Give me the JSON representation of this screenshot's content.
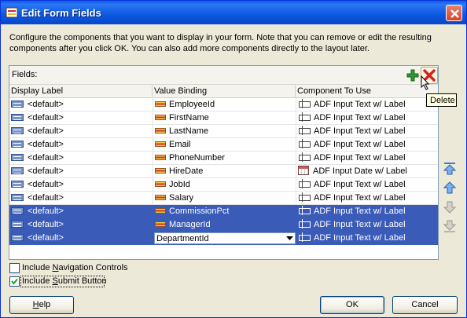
{
  "dialog": {
    "title": "Edit Form Fields",
    "description": "Configure the components that you want to display in your form.  Note that you can remove or edit the resulting components after you click OK.  You can also add more components directly to the layout later."
  },
  "fields": {
    "label": "Fields:",
    "add_icon": "add-icon",
    "delete_icon": "delete-icon",
    "tooltip": "Delete",
    "columns": [
      "Display Label",
      "Value Binding",
      "Component To Use"
    ],
    "rows": [
      {
        "label": "<default>",
        "binding": "EmployeeId",
        "component": "ADF Input Text w/ Label",
        "icon": "input-text-icon",
        "selected": false
      },
      {
        "label": "<default>",
        "binding": "FirstName",
        "component": "ADF Input Text w/ Label",
        "icon": "input-text-icon",
        "selected": false
      },
      {
        "label": "<default>",
        "binding": "LastName",
        "component": "ADF Input Text w/ Label",
        "icon": "input-text-icon",
        "selected": false
      },
      {
        "label": "<default>",
        "binding": "Email",
        "component": "ADF Input Text w/ Label",
        "icon": "input-text-icon",
        "selected": false
      },
      {
        "label": "<default>",
        "binding": "PhoneNumber",
        "component": "ADF Input Text w/ Label",
        "icon": "input-text-icon",
        "selected": false
      },
      {
        "label": "<default>",
        "binding": "HireDate",
        "component": "ADF Input Date w/ Label",
        "icon": "input-date-icon",
        "selected": false
      },
      {
        "label": "<default>",
        "binding": "JobId",
        "component": "ADF Input Text w/ Label",
        "icon": "input-text-icon",
        "selected": false
      },
      {
        "label": "<default>",
        "binding": "Salary",
        "component": "ADF Input Text w/ Label",
        "icon": "input-text-icon",
        "selected": false
      },
      {
        "label": "<default>",
        "binding": "CommissionPct",
        "component": "ADF Input Text w/ Label",
        "icon": "input-text-icon",
        "selected": true
      },
      {
        "label": "<default>",
        "binding": "ManagerId",
        "component": "ADF Input Text w/ Label",
        "icon": "input-text-icon",
        "selected": true
      },
      {
        "label": "<default>",
        "binding": "DepartmentId",
        "component": "ADF Input Text w/ Label",
        "icon": "input-text-icon",
        "selected": true,
        "editing": true
      }
    ]
  },
  "side_buttons": [
    "move-top-icon",
    "move-up-icon",
    "move-down-icon",
    "move-bottom-icon"
  ],
  "options": {
    "nav_controls": {
      "label_pre": "Include ",
      "label_key": "N",
      "label_post": "avigation Controls",
      "checked": false
    },
    "submit_button": {
      "label_pre": "Include ",
      "label_key": "S",
      "label_post": "ubmit Button",
      "checked": true
    }
  },
  "buttons": {
    "help_key": "H",
    "help_rest": "elp",
    "ok": "OK",
    "cancel": "Cancel"
  },
  "colors": {
    "title_bar": "#0a5ae4",
    "selection": "#3a5bb7",
    "add": "#2e9b2e",
    "delete": "#d42020"
  }
}
